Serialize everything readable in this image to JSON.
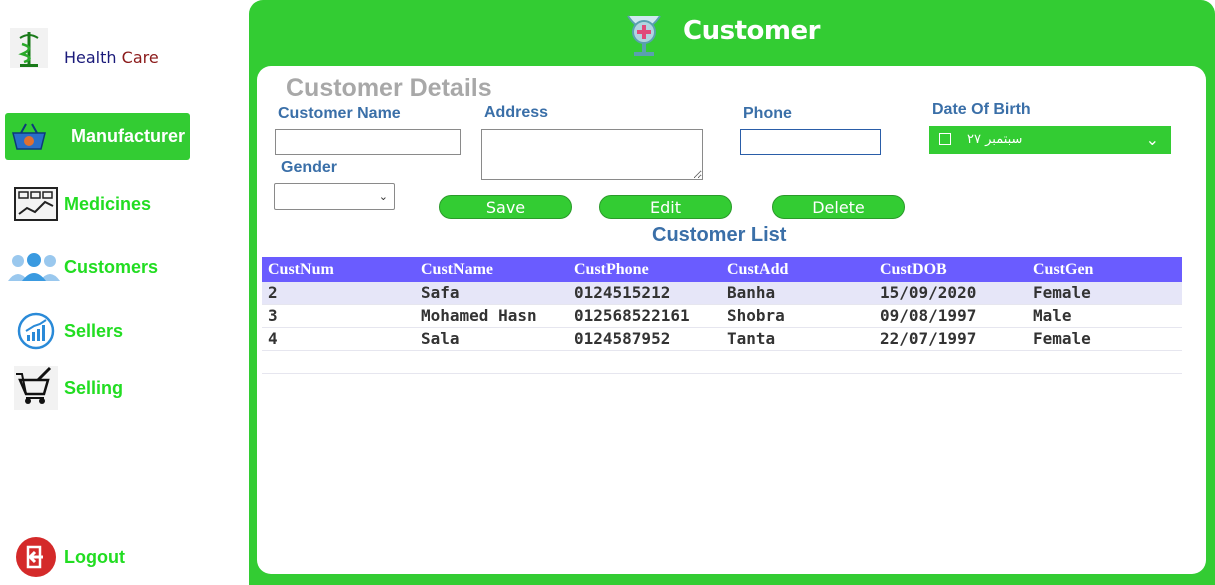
{
  "brand": {
    "part1": "Health",
    "part2": "Care"
  },
  "sidebar": {
    "items": [
      {
        "label": "Manufacturer",
        "icon": "basket-icon"
      },
      {
        "label": "Medicines",
        "icon": "chart-board-icon"
      },
      {
        "label": "Customers",
        "icon": "users-icon"
      },
      {
        "label": "Sellers",
        "icon": "growth-chart-icon"
      },
      {
        "label": "Selling",
        "icon": "cart-mortar-icon"
      }
    ],
    "logout": "Logout"
  },
  "header": {
    "title": "Customer"
  },
  "form": {
    "section_title": "Customer Details",
    "name_label": "Customer Name",
    "address_label": "Address",
    "phone_label": "Phone",
    "dob_label": "Date Of Birth",
    "gender_label": "Gender",
    "name_value": "",
    "address_value": "",
    "phone_value": "",
    "gender_value": "",
    "dob_value": "سبتمبر ٢٧"
  },
  "buttons": {
    "save": "Save",
    "edit": "Edit",
    "delete": "Delete"
  },
  "list": {
    "title": "Customer List",
    "columns": [
      "CustNum",
      "CustName",
      "CustPhone",
      "CustAdd",
      "CustDOB",
      "CustGen"
    ],
    "rows": [
      [
        "2",
        "Safa",
        "0124515212",
        "Banha",
        "15/09/2020",
        "Female"
      ],
      [
        "3",
        "Mohamed Hasn",
        "012568522161",
        "Shobra",
        "09/08/1997",
        "Male"
      ],
      [
        "4",
        "Sala",
        "0124587952",
        "Tanta",
        "22/07/1997",
        "Female"
      ]
    ]
  },
  "colors": {
    "accent": "#33cc33",
    "header": "#6a5cff",
    "label": "#3a6fa8",
    "nav_text": "#22dd22"
  }
}
